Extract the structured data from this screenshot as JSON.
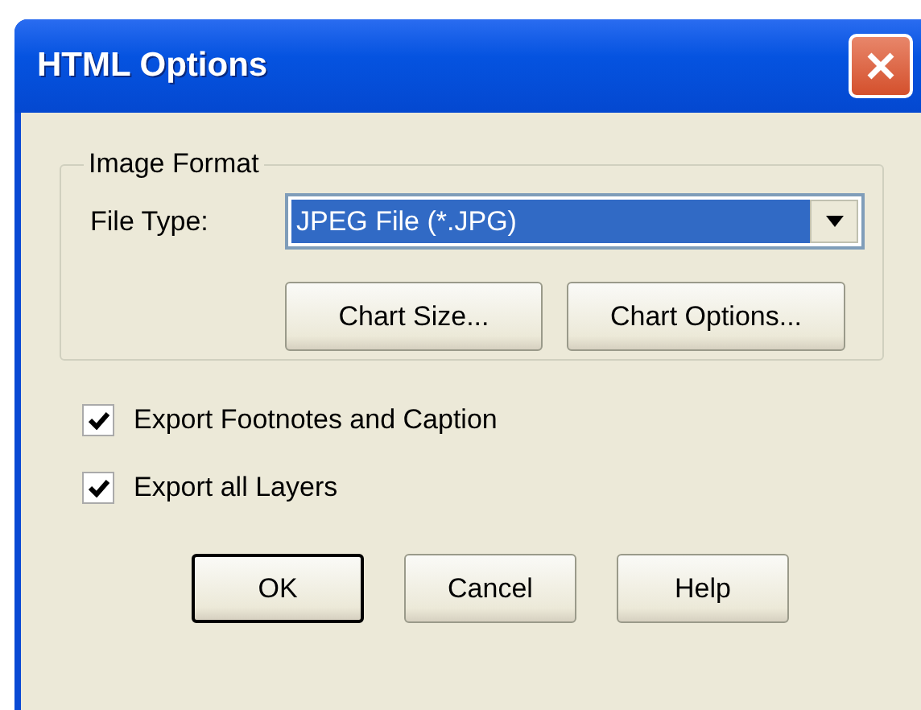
{
  "window": {
    "title": "HTML Options"
  },
  "image_format": {
    "legend": "Image Format",
    "file_type_label": "File Type:",
    "file_type": {
      "value": "JPEG File (*.JPG)",
      "highlighted": true
    },
    "buttons": [
      {
        "label": "Chart Size..."
      },
      {
        "label": "Chart Options..."
      }
    ]
  },
  "options": [
    {
      "label": "Export Footnotes and Caption",
      "checked": true
    },
    {
      "label": "Export all Layers",
      "checked": true
    }
  ],
  "buttons": [
    {
      "label": "OK",
      "default": true
    },
    {
      "label": "Cancel",
      "default": false
    },
    {
      "label": "Help",
      "default": false
    }
  ]
}
